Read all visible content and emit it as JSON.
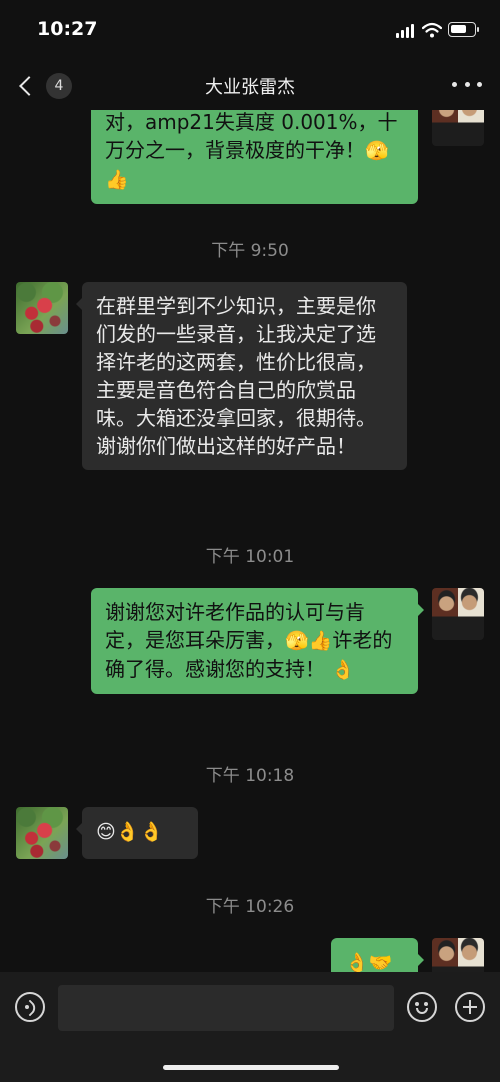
{
  "status_bar": {
    "time": "10:27"
  },
  "header": {
    "back_count": "4",
    "title": "大业张雷杰"
  },
  "messages": [
    {
      "side": "out",
      "text": "对，amp21失真度 0.001%，十万分之一，背景极度的干净！",
      "emoji": "🫣👍"
    },
    {
      "type": "timestamp",
      "text": "下午 9:50"
    },
    {
      "side": "in",
      "text": "在群里学到不少知识，主要是你们发的一些录音，让我决定了选择许老的这两套，性价比很高，主要是音色符合自己的欣赏品味。大箱还没拿回家，很期待。谢谢你们做出这样的好产品！"
    },
    {
      "type": "timestamp",
      "text": "下午 10:01"
    },
    {
      "side": "out",
      "text_a": "谢谢您对许老作品的认可与肯定，是您耳朵厉害，",
      "emoji_a": "🫣👍",
      "text_b": "许老的确了得。感谢您的支持！",
      "emoji_b": "👌"
    },
    {
      "type": "timestamp",
      "text": "下午 10:18"
    },
    {
      "side": "in",
      "emoji": "😊👌👌"
    },
    {
      "type": "timestamp",
      "text": "下午 10:26"
    },
    {
      "side": "out",
      "emoji": "👌🤝"
    }
  ],
  "icons": [
    "back-chevron-icon",
    "more-icon",
    "voice-icon",
    "emoji-icon",
    "plus-icon"
  ]
}
